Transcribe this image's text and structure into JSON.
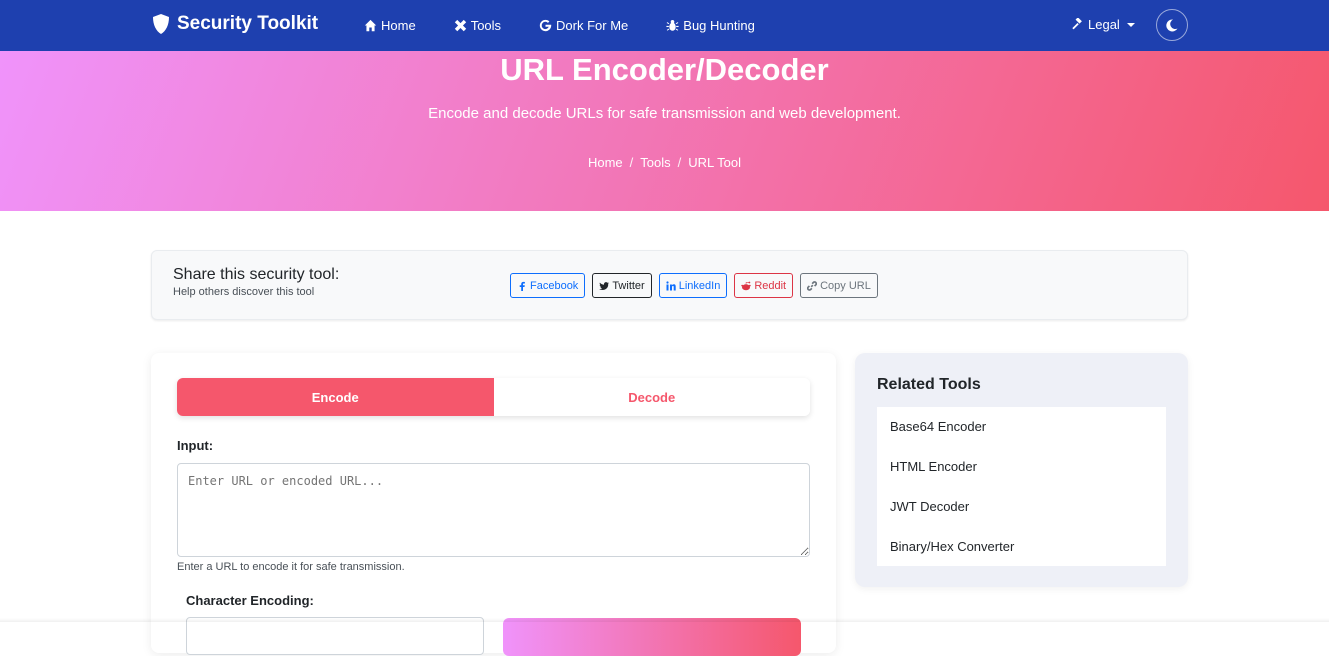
{
  "navbar": {
    "brand": "Security Toolkit",
    "links": [
      {
        "label": "Home",
        "icon": "home-icon"
      },
      {
        "label": "Tools",
        "icon": "tools-icon"
      },
      {
        "label": "Dork For Me",
        "icon": "google-icon"
      },
      {
        "label": "Bug Hunting",
        "icon": "bug-icon"
      }
    ],
    "legal": "Legal"
  },
  "hero": {
    "title": "URL Encoder/Decoder",
    "subtitle": "Encode and decode URLs for safe transmission and web development.",
    "breadcrumb": [
      "Home",
      "Tools",
      "URL Tool"
    ]
  },
  "share": {
    "title": "Share this security tool:",
    "subtitle": "Help others discover this tool",
    "buttons": [
      "Facebook",
      "Twitter",
      "LinkedIn",
      "Reddit",
      "Copy URL"
    ]
  },
  "tool": {
    "tabs": [
      "Encode",
      "Decode"
    ],
    "input_label": "Input:",
    "input_placeholder": "Enter URL or encoded URL...",
    "helper": "Enter a URL to encode it for safe transmission.",
    "encoding_label": "Character Encoding:"
  },
  "related": {
    "title": "Related Tools",
    "items": [
      "Base64 Encoder",
      "HTML Encoder",
      "JWT Decoder",
      "Binary/Hex Converter"
    ]
  },
  "colors": {
    "navbar": "#1e40af",
    "gradient_start": "#f093fb",
    "gradient_end": "#f5576c",
    "accent": "#f5576c"
  }
}
